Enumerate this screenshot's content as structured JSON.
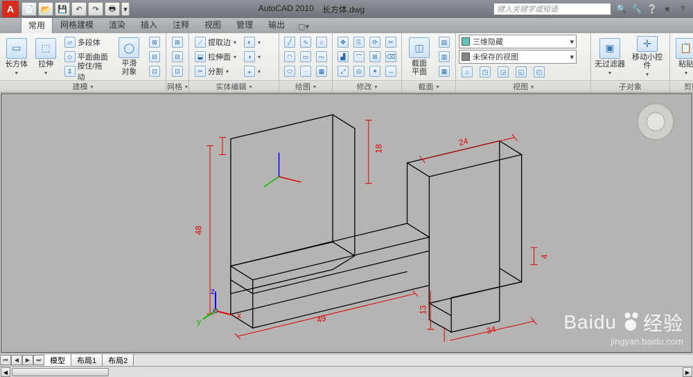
{
  "title": {
    "app": "AutoCAD 2010",
    "file": "长方体.dwg"
  },
  "search": {
    "placeholder": "键入关键字或短语"
  },
  "tabs": [
    "常用",
    "网格建模",
    "渲染",
    "插入",
    "注释",
    "视图",
    "管理",
    "输出"
  ],
  "active_tab_index": 0,
  "panels": {
    "modeling": {
      "title": "建模",
      "box": "长方体",
      "extrude": "拉伸",
      "polysolid": "多段体",
      "planesurf": "平面曲面",
      "presspull": "按住/拖动",
      "smooth": "平滑\n对象",
      "extract": "提取边",
      "presspull2": "拉伸面",
      "split": "分割"
    },
    "mesh": {
      "title": "网格"
    },
    "solidedit": {
      "title": "实体编辑"
    },
    "draw": {
      "title": "绘图"
    },
    "modify": {
      "title": "修改"
    },
    "section": {
      "title": "截面",
      "plane": "截面\n平面"
    },
    "view": {
      "title": "视图",
      "hide": "三维隐藏",
      "unsaved": "未保存的视图"
    },
    "subobject": {
      "title": "子对象",
      "nofilter": "无过滤器",
      "gizmo": "移动小控件"
    },
    "clipboard": {
      "title": "剪贴板",
      "paste": "粘贴"
    }
  },
  "layout_tabs": [
    "模型",
    "布局1",
    "布局2"
  ],
  "dimensions": {
    "d48": "48",
    "d18": "18",
    "d24": "24",
    "d4": "4",
    "d13": "13",
    "d34": "34",
    "d49": "49"
  },
  "ucs": {
    "x": "x",
    "y": "y",
    "z": "z"
  },
  "watermark": {
    "brand": "Baidu",
    "sub": "经验",
    "url": "jingyan.baidu.com"
  }
}
